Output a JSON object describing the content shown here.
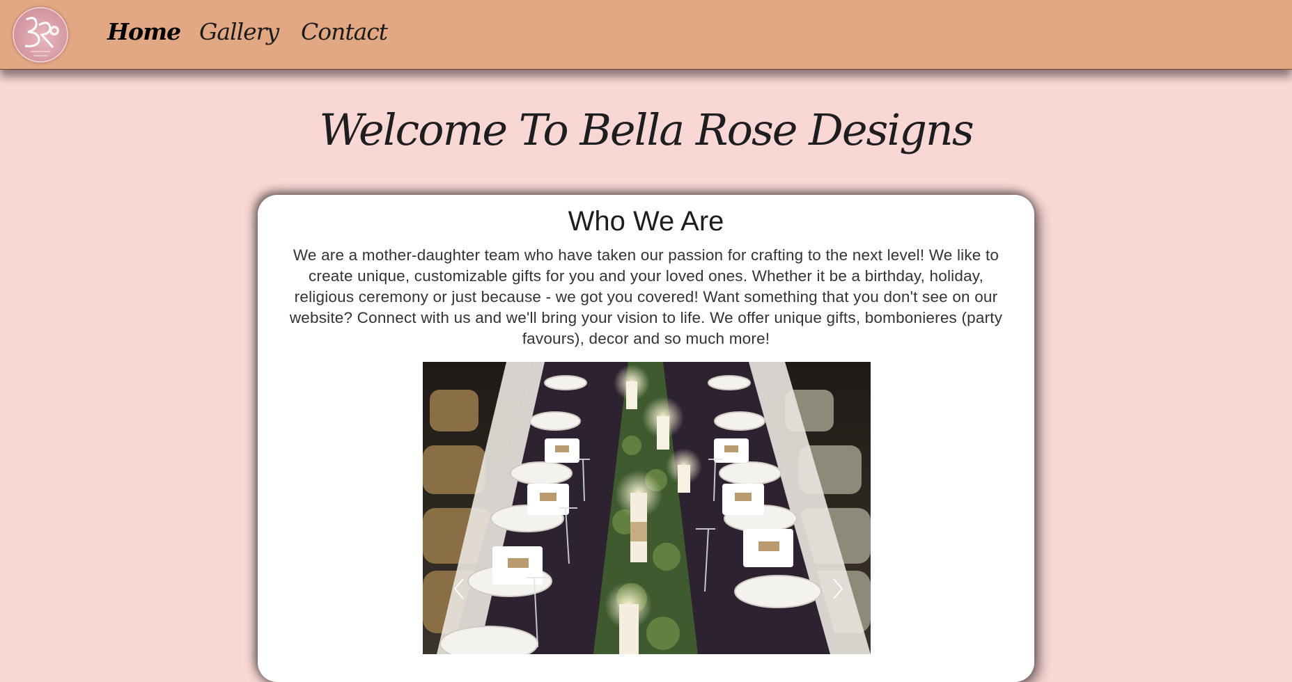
{
  "brand": {
    "logo_name": "Bella Rose Designs logo"
  },
  "nav": {
    "links": [
      {
        "label": "Home",
        "active": true
      },
      {
        "label": "Gallery",
        "active": false
      },
      {
        "label": "Contact",
        "active": false
      }
    ]
  },
  "page": {
    "title": "Welcome To Bella Rose Designs"
  },
  "about": {
    "heading": "Who We Are",
    "body": "We are a mother-daughter team who have taken our passion for crafting to the next level! We like to create unique, customizable gifts for you and your loved ones. Whether it be a birthday, holiday, religious ceremony or just because - we got you covered! Want something that you don't see on our website? Connect with us and we'll bring your vision to life. We offer unique gifts, bombonieres (party favours), decor and so much more!"
  },
  "carousel": {
    "prev_icon": "chevron-left-icon",
    "next_icon": "chevron-right-icon",
    "image_alt": "Decorated banquet table with candles and greenery"
  },
  "colors": {
    "nav_bg": "#e2a883",
    "page_bg": "#f8d7d4",
    "card_bg": "#ffffff",
    "text": "#1d1d1d"
  }
}
